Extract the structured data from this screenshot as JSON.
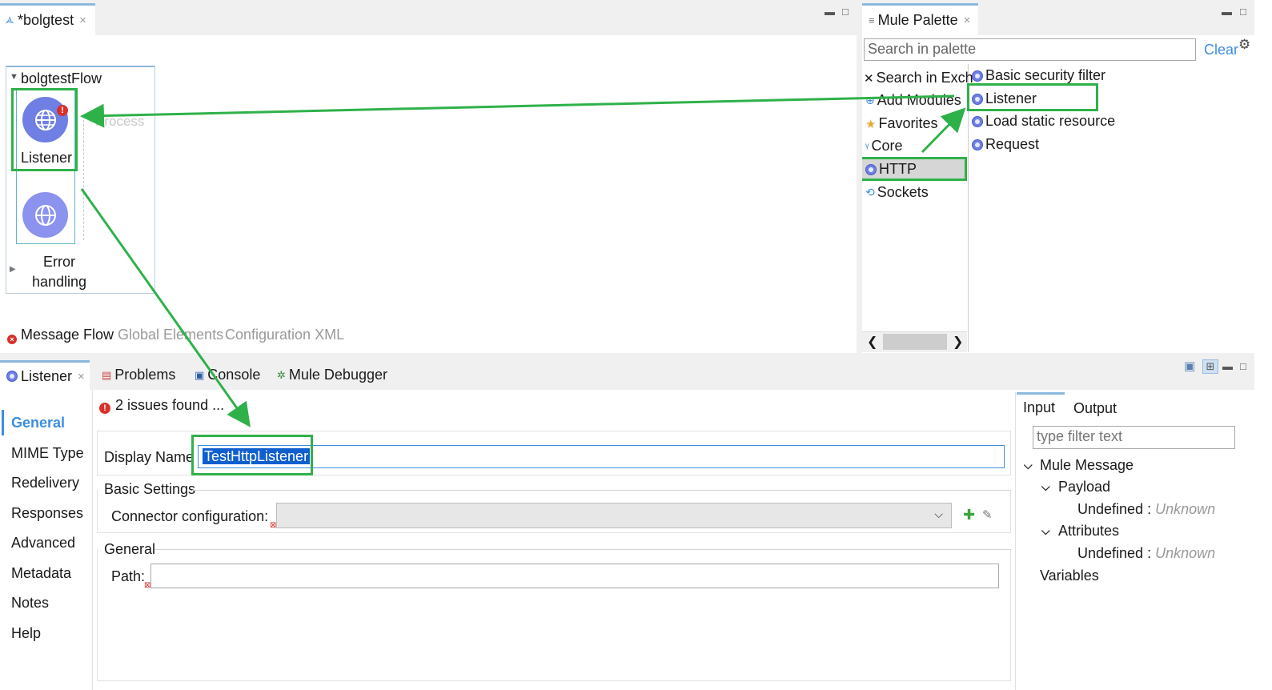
{
  "editor": {
    "tab_label": "*bolgtest",
    "flow_name": "bolgtestFlow",
    "process_label": "Process",
    "listener_label": "Listener",
    "error_handling_line1": "Error",
    "error_handling_line2": "handling",
    "bottom_tabs": [
      "Message Flow",
      "Global Elements",
      "Configuration XML"
    ]
  },
  "palette": {
    "tab_label": "Mule Palette",
    "search_placeholder": "Search in palette",
    "clear_label": "Clear",
    "categories": [
      {
        "label": "Search in Exch",
        "icon": "exchange-icon"
      },
      {
        "label": "Add Modules",
        "icon": "add-icon"
      },
      {
        "label": "Favorites",
        "icon": "star-icon"
      },
      {
        "label": "Core",
        "icon": "mule-icon"
      },
      {
        "label": "HTTP",
        "icon": "http-icon"
      },
      {
        "label": "Sockets",
        "icon": "sockets-icon"
      }
    ],
    "operations": [
      "Basic security filter",
      "Listener",
      "Load static resource",
      "Request"
    ]
  },
  "properties": {
    "tabs": [
      "Listener",
      "Problems",
      "Console",
      "Mule Debugger"
    ],
    "issues_text": "2 issues found ...",
    "side_nav": [
      "General",
      "MIME Type",
      "Redelivery",
      "Responses",
      "Advanced",
      "Metadata",
      "Notes",
      "Help"
    ],
    "display_name_label": "Display Name",
    "display_name_value": "TestHttpListener",
    "basic_settings_label": "Basic Settings",
    "connector_config_label": "Connector configuration:",
    "general_section_label": "General",
    "path_label": "Path:"
  },
  "metadata": {
    "tabs": [
      "Input",
      "Output"
    ],
    "filter_placeholder": "type filter text",
    "tree": {
      "mule_message": "Mule Message",
      "payload": "Payload",
      "payload_value_key": "Undefined :",
      "payload_value_type": "Unknown",
      "attributes": "Attributes",
      "attributes_value_key": "Undefined :",
      "attributes_value_type": "Unknown",
      "variables": "Variables"
    }
  },
  "colors": {
    "highlight_green": "#2fb14a",
    "link_blue": "#3d8ee0",
    "selection_blue": "#0f5fce",
    "component_purple": "#6f7fe3"
  }
}
